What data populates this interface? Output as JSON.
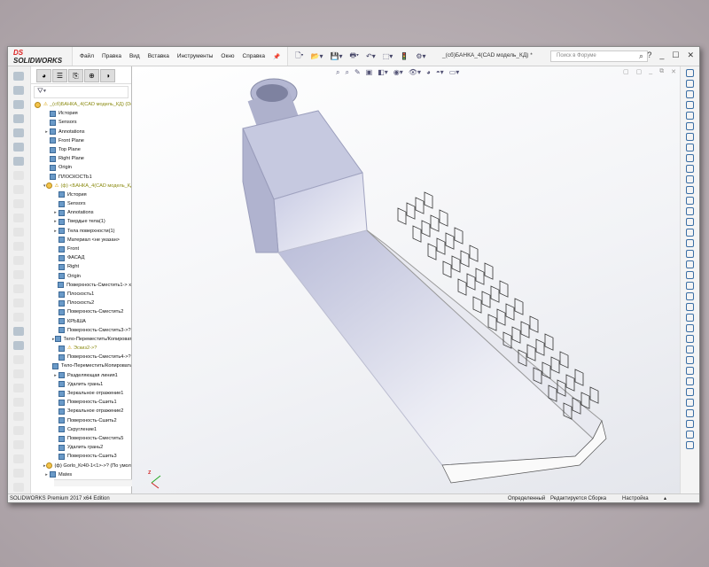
{
  "app": {
    "brand_prefix": "DS",
    "brand": "SOLIDWORKS",
    "document_title": "_(сб)БАНКА_4(CAD модель_КД) *"
  },
  "menu": [
    "Файл",
    "Правка",
    "Вид",
    "Вставка",
    "Инструменты",
    "Окно",
    "Справка"
  ],
  "search": {
    "placeholder": "Поиск в Форуме"
  },
  "window_controls": {
    "help": "?",
    "minimize": "_",
    "maximize": "☐",
    "close": "✕"
  },
  "panel_tabs": [
    "feature-manager",
    "property-manager",
    "configuration-manager",
    "dimxpert",
    "display-manager"
  ],
  "tree": [
    {
      "label": "_(сб)БАНКА_4(CAD модель_КД) (Default",
      "level": 0,
      "icon": "assembly",
      "warn": true,
      "yellow": true
    },
    {
      "label": "История",
      "level": 1,
      "icon": "history"
    },
    {
      "label": "Sensors",
      "level": 1,
      "icon": "sensor"
    },
    {
      "label": "Annotations",
      "level": 1,
      "icon": "annotation",
      "expand": "▸"
    },
    {
      "label": "Front Plane",
      "level": 1,
      "icon": "plane"
    },
    {
      "label": "Top Plane",
      "level": 1,
      "icon": "plane"
    },
    {
      "label": "Right Plane",
      "level": 1,
      "icon": "plane"
    },
    {
      "label": "Origin",
      "level": 1,
      "icon": "origin"
    },
    {
      "label": "ПЛОСКОСТЬ1",
      "level": 1,
      "icon": "plane"
    },
    {
      "label": "(ф) <БАНКА_4(CAD модель_КД)",
      "level": 1,
      "icon": "part",
      "warn": true,
      "yellow": true,
      "expand": "▾"
    },
    {
      "label": "История",
      "level": 2,
      "icon": "history"
    },
    {
      "label": "Sensors",
      "level": 2,
      "icon": "sensor"
    },
    {
      "label": "Annotations",
      "level": 2,
      "icon": "annotation",
      "expand": "▸"
    },
    {
      "label": "Твердые тела(1)",
      "level": 2,
      "icon": "solid",
      "expand": "▸"
    },
    {
      "label": "Тела поверхности(1)",
      "level": 2,
      "icon": "surface",
      "expand": "▸"
    },
    {
      "label": "Материал <не указан>",
      "level": 2,
      "icon": "material"
    },
    {
      "label": "Front",
      "level": 2,
      "icon": "plane"
    },
    {
      "label": "ФАСАД",
      "level": 2,
      "icon": "plane"
    },
    {
      "label": "Right",
      "level": 2,
      "icon": "plane"
    },
    {
      "label": "Origin",
      "level": 2,
      "icon": "origin"
    },
    {
      "label": "Поверхность-Сместить1-> x",
      "level": 2,
      "icon": "offset"
    },
    {
      "label": "Плоскость1",
      "level": 2,
      "icon": "plane"
    },
    {
      "label": "Плоскость2",
      "level": 2,
      "icon": "plane"
    },
    {
      "label": "Поверхность-Сместить2",
      "level": 2,
      "icon": "offset"
    },
    {
      "label": "КРЫША",
      "level": 2,
      "icon": "feature"
    },
    {
      "label": "Поверхность-Сместить3->?",
      "level": 2,
      "icon": "offset"
    },
    {
      "label": "Тело-Переместить/Копировать",
      "level": 2,
      "icon": "move",
      "expand": "▸"
    },
    {
      "label": "Эскиз2->?",
      "level": 2,
      "icon": "sketch",
      "warn": true,
      "yellow": true
    },
    {
      "label": "Поверхность-Сместить4->?",
      "level": 2,
      "icon": "offset"
    },
    {
      "label": "Тело-Переместить/Копировать",
      "level": 2,
      "icon": "move"
    },
    {
      "label": "Разделяющая линия1",
      "level": 2,
      "icon": "split",
      "expand": "▸"
    },
    {
      "label": "Удалить грань1",
      "level": 2,
      "icon": "delete-face"
    },
    {
      "label": "Зеркальное отражение1",
      "level": 2,
      "icon": "mirror"
    },
    {
      "label": "Поверхность-Сшить1",
      "level": 2,
      "icon": "knit"
    },
    {
      "label": "Зеркальное отражение2",
      "level": 2,
      "icon": "mirror"
    },
    {
      "label": "Поверхность-Сшить2",
      "level": 2,
      "icon": "knit"
    },
    {
      "label": "Скругление1",
      "level": 2,
      "icon": "fillet"
    },
    {
      "label": "Поверхность-Сместить5",
      "level": 2,
      "icon": "offset"
    },
    {
      "label": "Удалить грань2",
      "level": 2,
      "icon": "delete-face"
    },
    {
      "label": "Поверхность-Сшить3",
      "level": 2,
      "icon": "knit"
    },
    {
      "label": "(ф) Gorlo_Kr40-1<1>->? (По умолчан",
      "level": 1,
      "icon": "part",
      "expand": "▸"
    },
    {
      "label": "Mates",
      "level": 1,
      "icon": "mates",
      "expand": "▸"
    }
  ],
  "status": {
    "edition": "SOLIDWORKS Premium 2017 x64 Edition",
    "state": "Определенный",
    "mode": "Редактируется Сборка",
    "units": "Настройка",
    "units_arrow": "▴"
  }
}
